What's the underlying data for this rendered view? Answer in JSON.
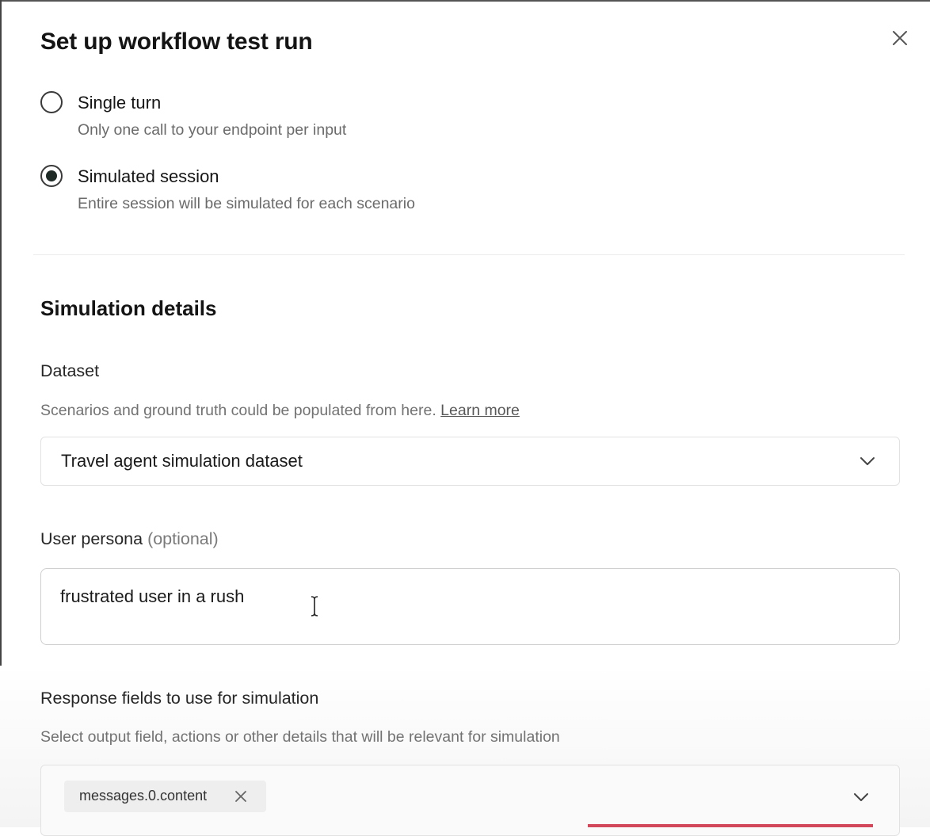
{
  "dialog": {
    "title": "Set up workflow test run",
    "close_icon": "close-icon"
  },
  "run_type": {
    "options": [
      {
        "label": "Single turn",
        "description": "Only one call to your endpoint per input",
        "selected": false
      },
      {
        "label": "Simulated session",
        "description": "Entire session will be simulated for each scenario",
        "selected": true
      }
    ]
  },
  "simulation": {
    "section_title": "Simulation details",
    "dataset": {
      "label": "Dataset",
      "help_text": "Scenarios and ground truth could be populated from here.",
      "help_link": "Learn more",
      "selected_value": "Travel agent simulation dataset",
      "dropdown_icon": "chevron-down-icon"
    },
    "persona": {
      "label": "User persona",
      "optional_tag": "(optional)",
      "value": "frustrated user in a rush"
    },
    "response_fields": {
      "label": "Response fields to use for simulation",
      "help_text": "Select output field, actions or other details that will be relevant for simulation",
      "chips": [
        "messages.0.content"
      ],
      "chip_remove_icon": "close-icon",
      "dropdown_icon": "chevron-down-icon"
    }
  },
  "colors": {
    "radio_selected": "#1d2a26",
    "accent_bar": "#d2485a",
    "border": "#e2e2e2"
  }
}
